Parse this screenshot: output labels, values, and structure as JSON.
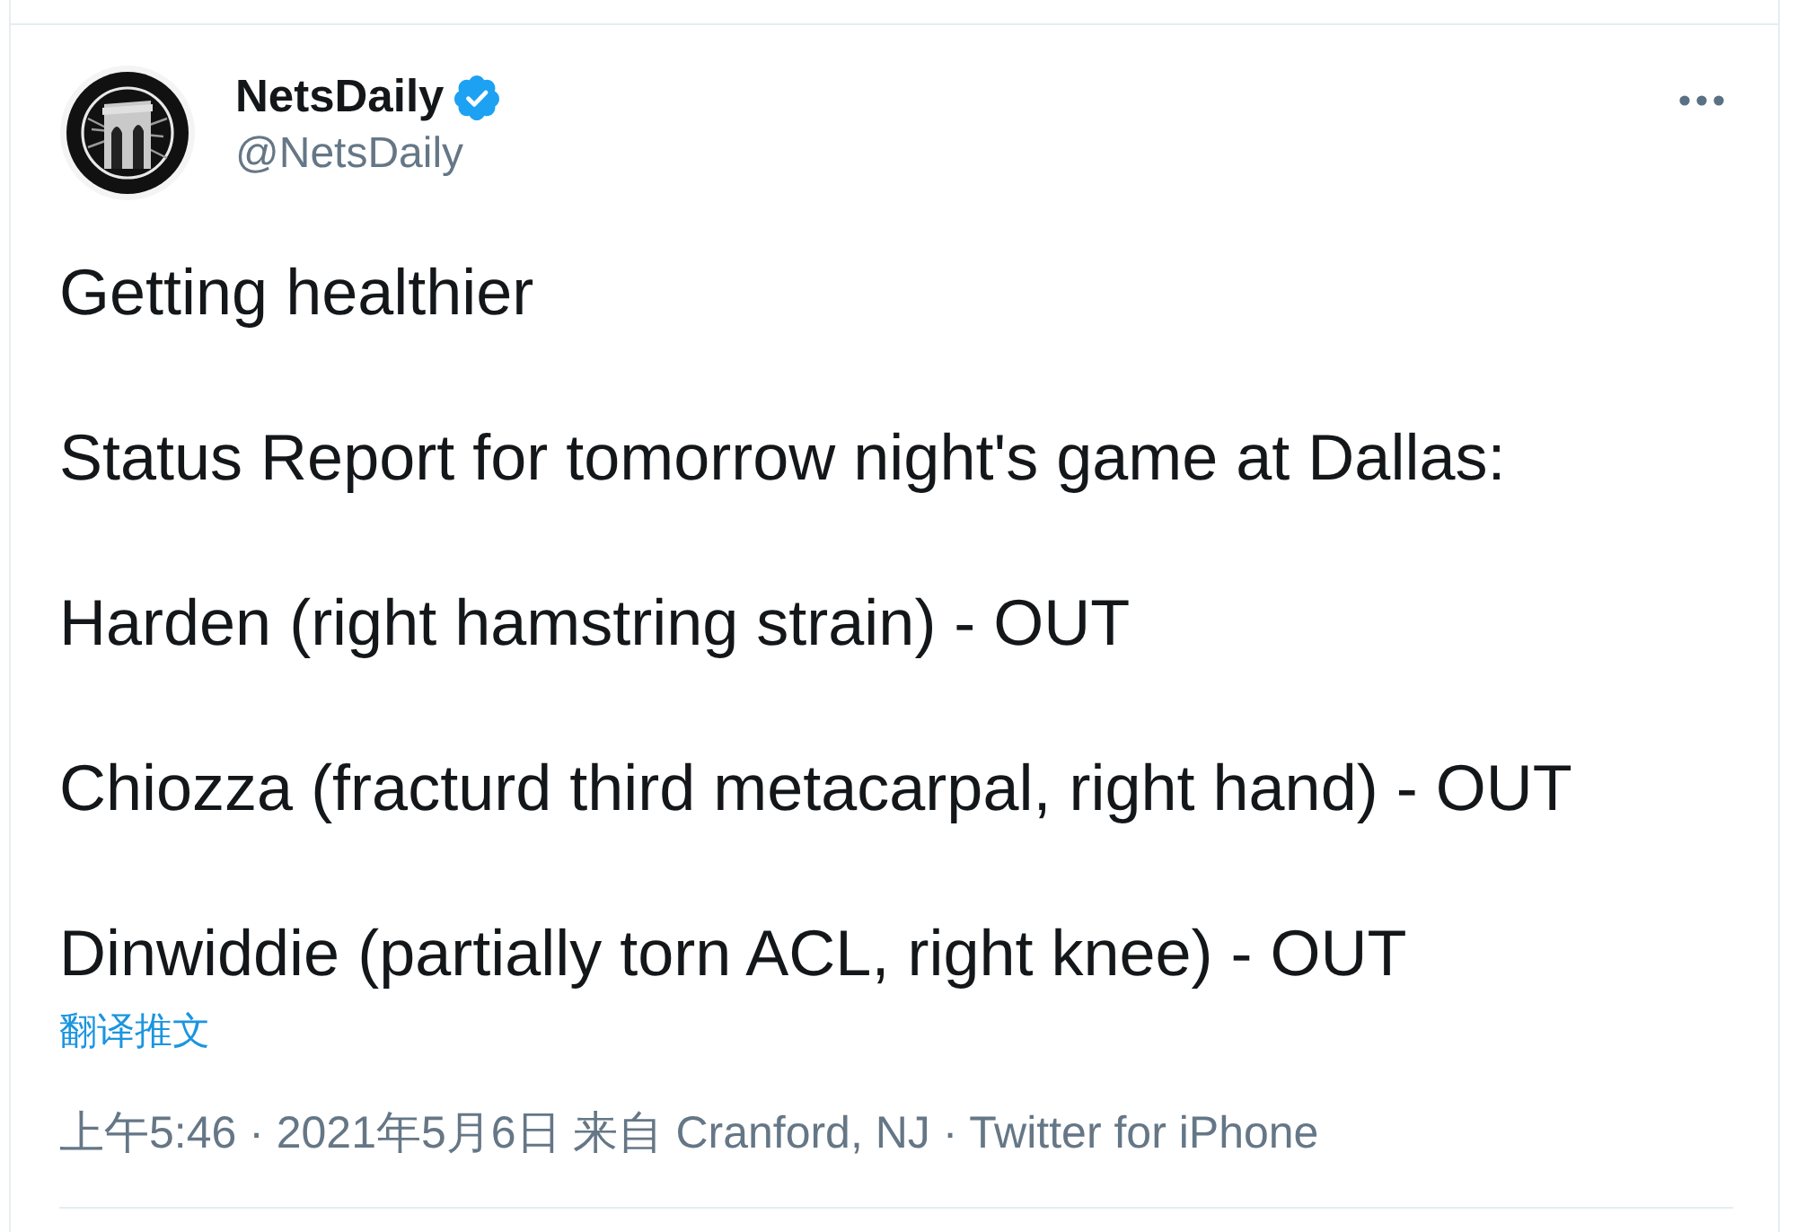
{
  "tweet": {
    "author": {
      "name": "NetsDaily",
      "verified": true,
      "handle": "@NetsDaily"
    },
    "paragraphs": [
      "Getting healthier",
      "Status Report for tomorrow night's game at Dallas:",
      "Harden (right hamstring strain) - OUT",
      "Chiozza (fracturd third metacarpal, right hand) - OUT",
      "Dinwiddie (partially torn ACL, right knee) - OUT"
    ],
    "translate_link": "翻译推文",
    "meta": "上午5:46 · 2021年5月6日 来自 Cranford, NJ · Twitter for iPhone"
  }
}
